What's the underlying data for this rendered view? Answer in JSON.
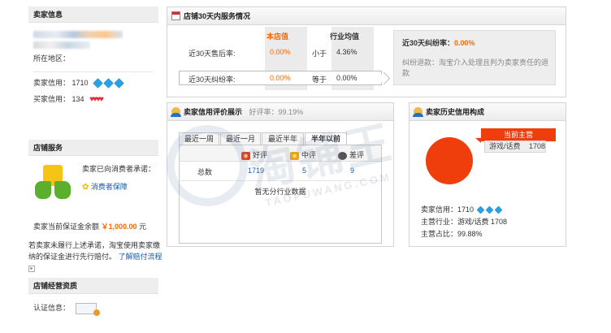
{
  "seller_info": {
    "title": "卖家信息",
    "location_label": "所在地区：",
    "seller_credit_label": "卖家信用：",
    "seller_credit_value": "1710",
    "buyer_credit_label": "买家信用：",
    "buyer_credit_value": "134"
  },
  "shop_service": {
    "title": "店铺服务",
    "promise_label": "卖家已向消费者承诺：",
    "promise_link": "消费者保障",
    "deposit_label": "卖家当前保证金余额",
    "deposit_amount": "￥1,000.00",
    "deposit_unit": "元",
    "note_line1": "若卖家未履行上述承诺，淘宝使用卖家缴",
    "note_line2": "纳的保证金进行先行赔付。",
    "note_link": "了解赔付流程"
  },
  "shop_qualification": {
    "title": "店铺经营资质",
    "cert_label": "认证信息："
  },
  "service_30d": {
    "title": "店铺30天内服务情况",
    "col_shop": "本店值",
    "col_industry": "行业均值",
    "rows": [
      {
        "label": "近30天售后率:",
        "shop": "0.00%",
        "compare": "小于",
        "industry": "4.36%"
      },
      {
        "label": "近30天纠纷率:",
        "shop": "0.00%",
        "compare": "等于",
        "industry": "0.00%"
      }
    ],
    "info_title": "近30天纠纷率：",
    "info_value": "0.00%",
    "info_desc": "纠纷退款：淘宝介入处理且判为卖家责任的退款"
  },
  "rating": {
    "title": "卖家信用评价展示",
    "rate_label": "好评率：",
    "rate_value": "99.19%",
    "tabs": [
      "最近一周",
      "最近一月",
      "最近半年",
      "半年以前"
    ],
    "head_good": "好评",
    "head_mid": "中评",
    "head_bad": "差评",
    "total_label": "总数",
    "total_good": "1719",
    "total_mid": "5",
    "total_bad": "9",
    "nodata": "暂无分行业数据"
  },
  "history": {
    "title": "卖家历史信用构成",
    "tag_top": "当前主营",
    "tag_category": "游戏/话费",
    "tag_value": "1708",
    "credit_label": "卖家信用：",
    "credit_value": "1710",
    "industry_label": "主营行业：",
    "industry_value": "游戏/话费 1708",
    "share_label": "主营占比：",
    "share_value": "99.88%",
    "chart_data": {
      "type": "pie",
      "categories": [
        "游戏/话费"
      ],
      "values": [
        99.88
      ]
    }
  },
  "watermark": {
    "text": "淘铺王",
    "sub": "TAOPUWANG.COM"
  },
  "colors": {
    "accent": "#ff6600",
    "link": "#1a5ba8",
    "pie": "#f03d0c",
    "diamond": "#2b9fe0",
    "heart": "#e0283a"
  }
}
